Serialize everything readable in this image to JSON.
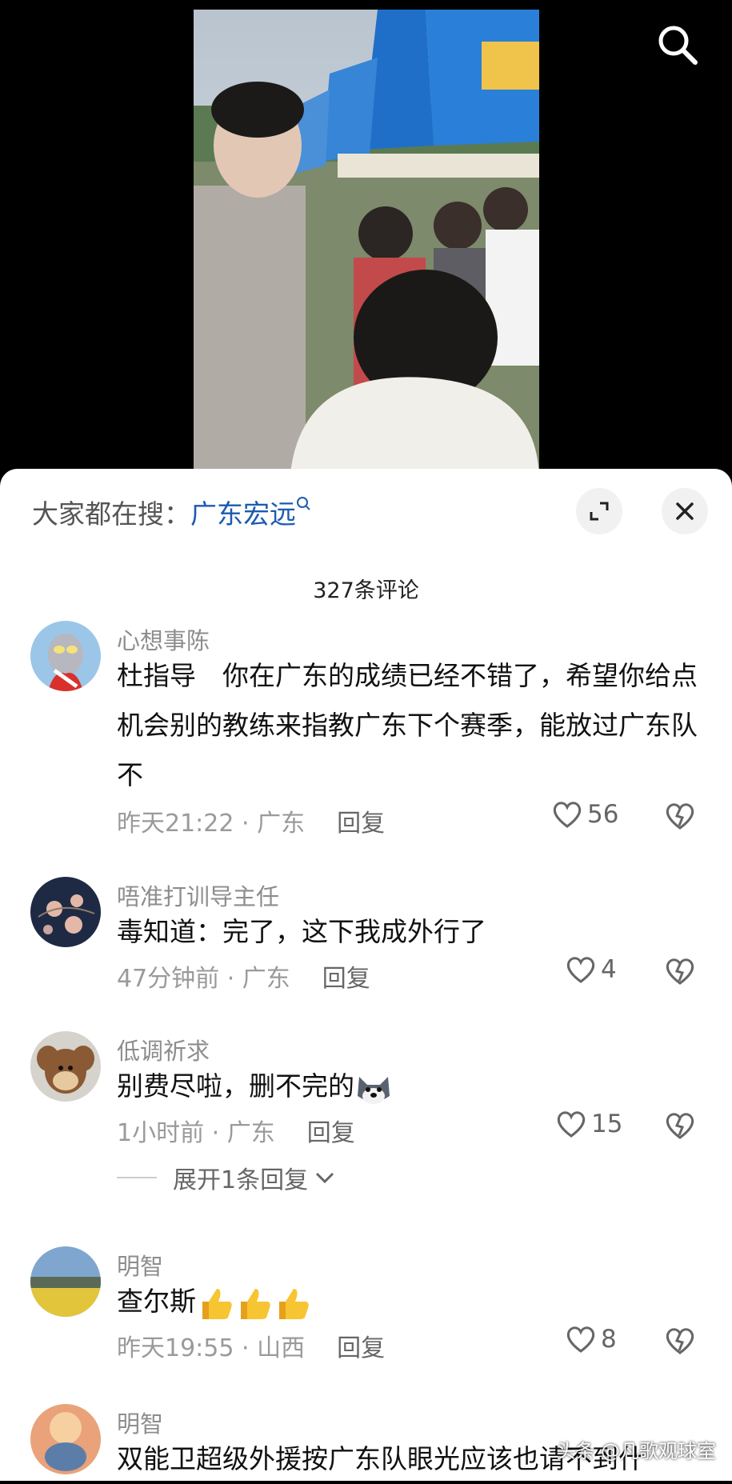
{
  "search": {
    "prefix": "大家都在搜：",
    "keyword": "广东宏远"
  },
  "comment_count": "327条评论",
  "comments": [
    {
      "user": "心想事陈",
      "text": "杜指导　你在广东的成绩已经不错了，希望你给点机会别的教练来指教广东下个赛季，能放过广东队不",
      "time": "昨天21:22",
      "location": "广东",
      "reply": "回复",
      "likes": "56"
    },
    {
      "user": "唔准打训导主任",
      "text": "毒知道：完了，这下我成外行了",
      "time": "47分钟前",
      "location": "广东",
      "reply": "回复",
      "likes": "4"
    },
    {
      "user": "低调祈求",
      "text": "别费尽啦，删不完的",
      "time": "1小时前",
      "location": "广东",
      "reply": "回复",
      "likes": "15",
      "expand": "展开1条回复"
    },
    {
      "user": "明智",
      "text": "查尔斯",
      "time": "昨天19:55",
      "location": "山西",
      "reply": "回复",
      "likes": "8"
    },
    {
      "user": "明智",
      "text": "双能卫超级外援按广东队眼光应该也请不到什"
    }
  ],
  "separator": " · ",
  "watermark": "头条 @凡歌观球室",
  "icons": [
    "search-icon",
    "expand-icon",
    "close-icon",
    "heart-icon",
    "broken-heart-icon",
    "chevron-down-icon",
    "thumbs-up-emoji",
    "husky-emoji"
  ],
  "colors": {
    "keyword": "#1c5bb0",
    "meta": "#9a9a9a"
  }
}
